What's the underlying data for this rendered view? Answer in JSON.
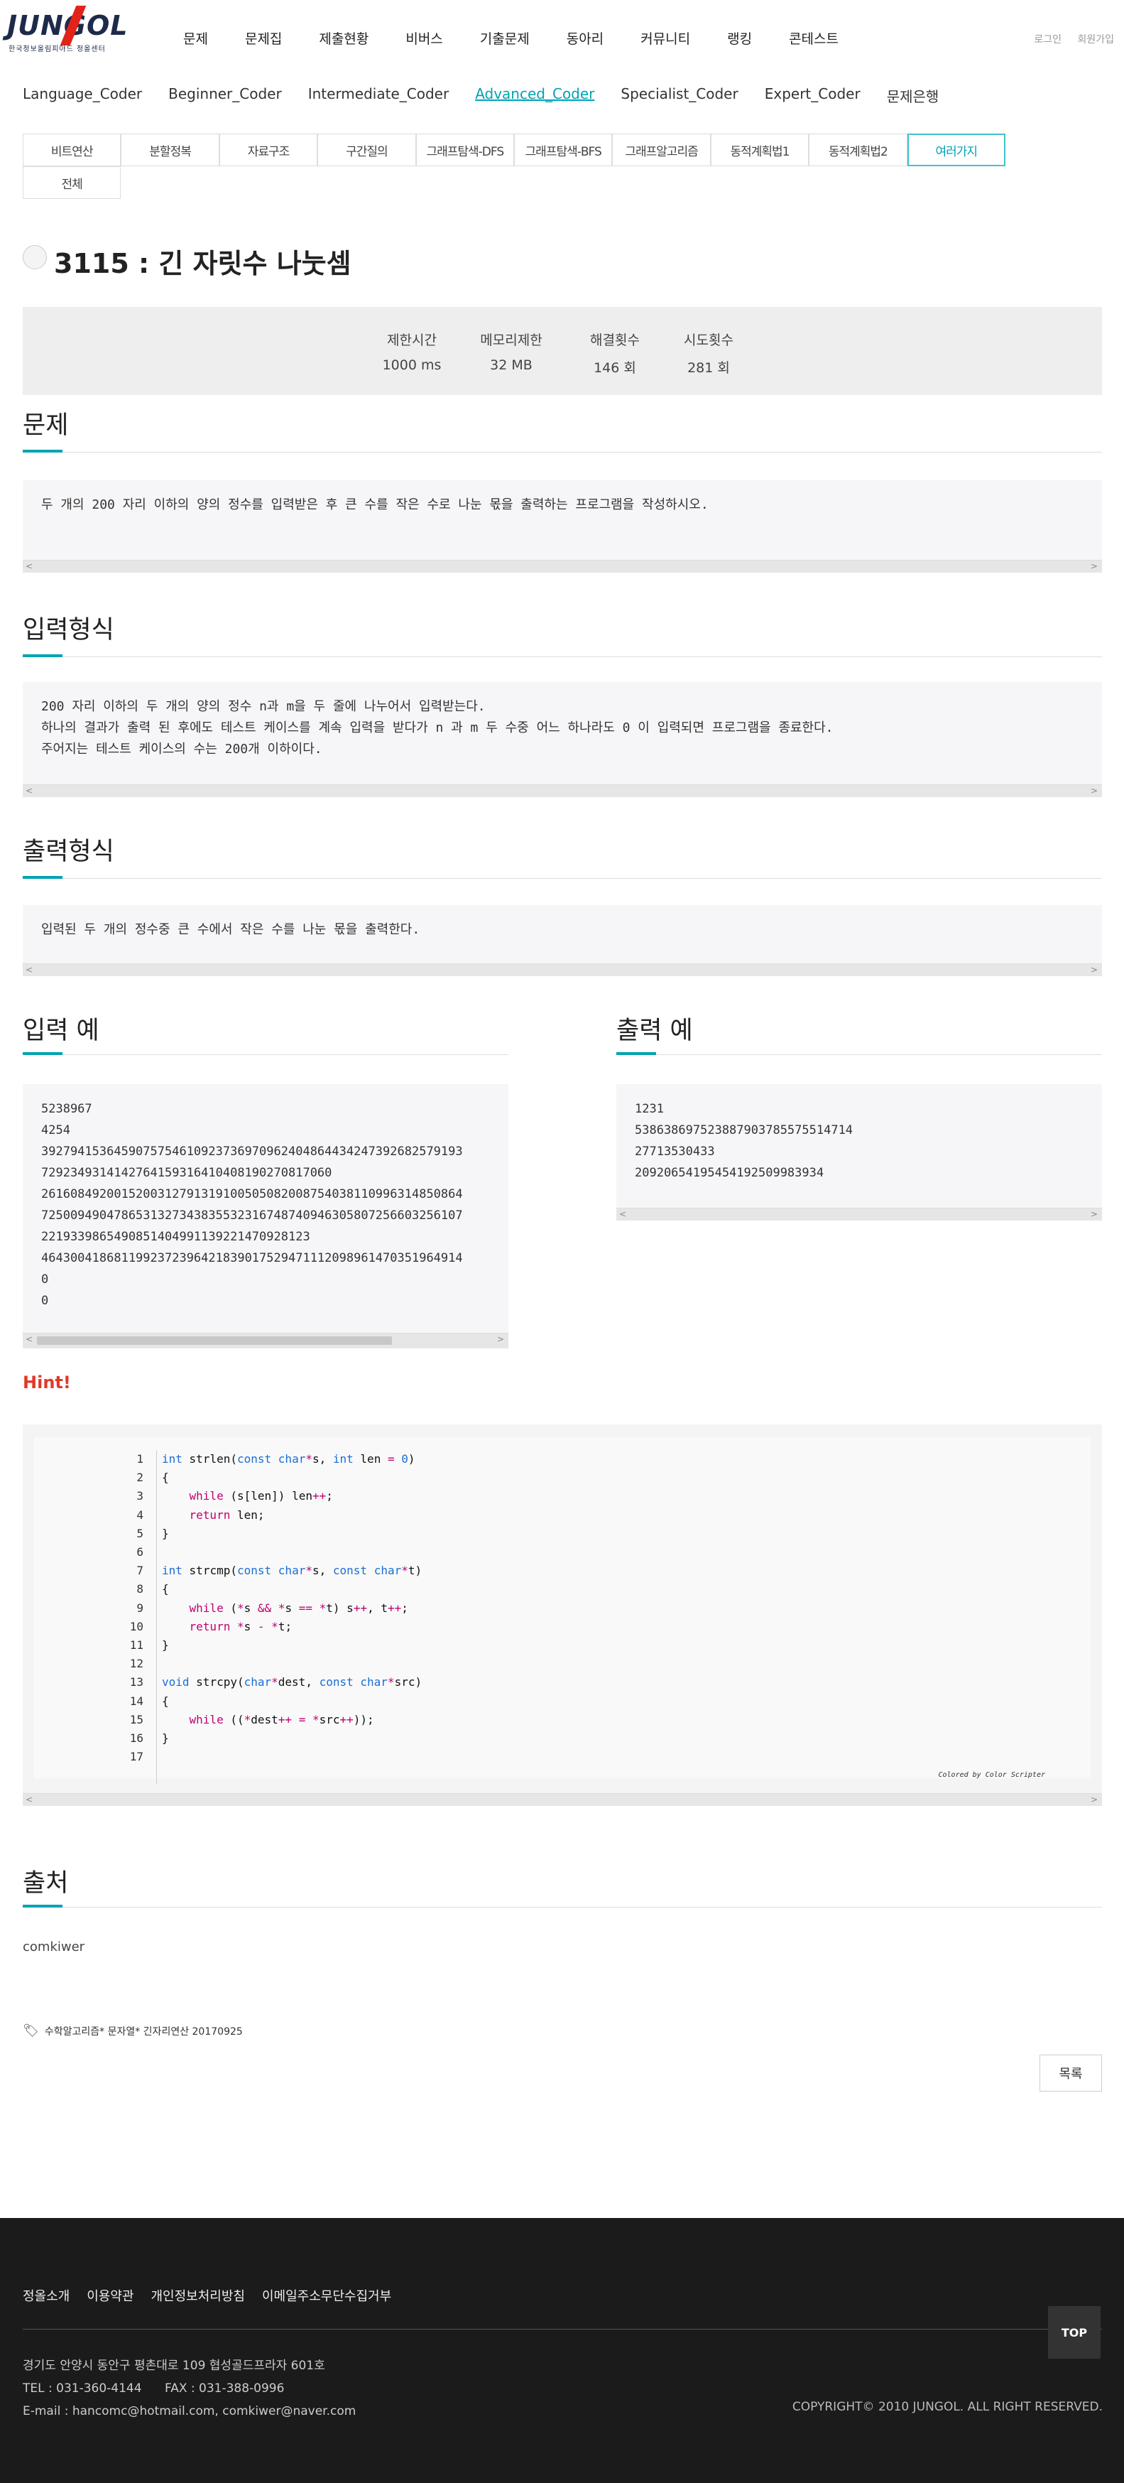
{
  "brand": {
    "logo_text": "JUNGOL",
    "logo_sub": "한국정보올림피아드 정올센터"
  },
  "gnb": [
    "문제",
    "문제집",
    "제출현황",
    "비버스",
    "기출문제",
    "동아리",
    "커뮤니티",
    "랭킹",
    "콘테스트"
  ],
  "util": [
    "로그인",
    "회원가입"
  ],
  "subnav": {
    "items": [
      "Language_Coder",
      "Beginner_Coder",
      "Intermediate_Coder",
      "Advanced_Coder",
      "Specialist_Coder",
      "Expert_Coder",
      "문제은행"
    ],
    "active_index": 3
  },
  "categories": {
    "items": [
      "비트연산",
      "분할정복",
      "자료구조",
      "구간질의",
      "그래프탐색-DFS",
      "그래프탐색-BFS",
      "그래프알고리즘",
      "동적계획법1",
      "동적계획법2",
      "여러가지",
      "전체"
    ],
    "active_index": 9
  },
  "problem": {
    "title": "3115 : 긴 자릿수 나눗셈"
  },
  "stats": [
    {
      "label": "제한시간",
      "value": "1000 ms"
    },
    {
      "label": "메모리제한",
      "value": "32 MB"
    },
    {
      "label": "해결횟수",
      "value": "146 회"
    },
    {
      "label": "시도횟수",
      "value": "281 회"
    }
  ],
  "sections": {
    "problem": {
      "title": "문제",
      "text": "두 개의 200 자리 이하의 양의 정수를 입력받은 후 큰 수를 작은 수로 나눈 몫을 출력하는 프로그램을 작성하시오."
    },
    "input": {
      "title": "입력형식",
      "lines": [
        "200 자리 이하의 두 개의 양의 정수 n과 m을 두 줄에 나누어서 입력받는다.",
        "하나의 결과가 출력 된 후에도 테스트 케이스를 계속 입력을 받다가 n 과 m 두 수중 어느 하나라도 0 이 입력되면 프로그램을 종료한다.",
        "주어지는 테스트 케이스의 수는 200개 이하이다."
      ]
    },
    "output": {
      "title": "출력형식",
      "text": "입력된 두 개의 정수중 큰 수에서 작은 수를 나눈 몫을 출력한다."
    },
    "sample_input": {
      "title": "입력 예",
      "lines": [
        "5238967",
        "4254",
        "3927941536459075754610923736970962404864434247392682579193",
        "7292349314142764159316410408190270817060",
        "2616084920015200312791319100505082008754038110996314850864",
        "7250094904786531327343835532316748740946305807256603256107",
        "2219339865490851404991139221470928123",
        "4643004186811992372396421839017529471112098961470351964914",
        "0",
        "0"
      ]
    },
    "sample_output": {
      "title": "출력 예",
      "lines": [
        "1231",
        "538638697523887903785575514714",
        "27713530433",
        "20920654195454192509983934"
      ]
    }
  },
  "hint": {
    "label": "Hint!",
    "code_lines": [
      "int strlen(const char*s, int len = 0)",
      "{",
      "    while (s[len]) len++;",
      "    return len;",
      "}",
      "",
      "int strcmp(const char*s, const char*t)",
      "{",
      "    while (*s && *s == *t) s++, t++;",
      "    return *s - *t;",
      "}",
      "",
      "void strcpy(char*dest, const char*src)",
      "{",
      "    while ((*dest++ = *src++));",
      "}",
      ""
    ],
    "credit": "Colored by Color Scripter"
  },
  "source": {
    "title": "출처",
    "author": "comkiwer"
  },
  "tagline": "수학알고리즘* 문자열* 긴자리연산 20170925",
  "list_button": "목록",
  "footer": {
    "links": [
      "정올소개",
      "이용약관",
      "개인정보처리방침",
      "이메일주소무단수집거부"
    ],
    "address": "경기도 안양시 동안구 평촌대로 109 협성골드프라자 601호",
    "phone": "TEL : 031-360-4144      FAX : 031-388-0996",
    "email": "E-mail : hancomc@hotmail.com, comkiwer@naver.com",
    "copyright": "COPYRIGHT© 2010 JUNGOL. ALL RIGHT RESERVED.",
    "top": "TOP"
  }
}
